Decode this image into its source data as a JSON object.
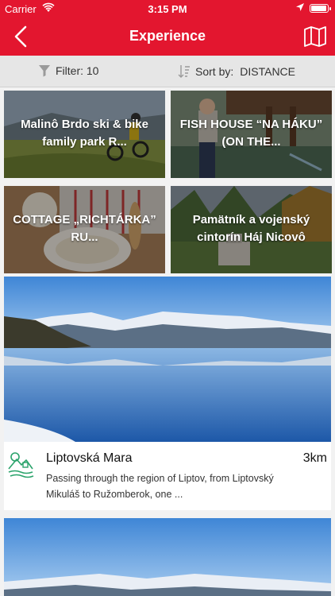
{
  "status": {
    "carrier": "Carrier",
    "time": "3:15 PM"
  },
  "nav": {
    "title": "Experience"
  },
  "toolbar": {
    "filter_label": "Filter: 10",
    "sort_label": "Sort by:",
    "sort_value": "DISTANCE"
  },
  "tiles": [
    {
      "label": "Malinô Brdo ski & bike family park R..."
    },
    {
      "label": "FISH HOUSE “NA HÁKU” (ON THE..."
    },
    {
      "label": "COTTAGE „RICHTÁRKA” RU..."
    },
    {
      "label": "Pamätník a vojenský cintorín Háj Nicovô"
    }
  ],
  "featured": {
    "name": "Liptovská Mara",
    "distance": "3km",
    "description": "Passing through the region of Liptov, from Liptovský Mikuláš to Ružomberok, one ..."
  },
  "colors": {
    "brand": "#e3162f",
    "icon_green": "#2aa36b"
  },
  "icons": {
    "back": "chevron-left-icon",
    "map": "map-icon",
    "filter": "funnel-icon",
    "sort": "sort-icon",
    "category": "landscape-icon"
  }
}
